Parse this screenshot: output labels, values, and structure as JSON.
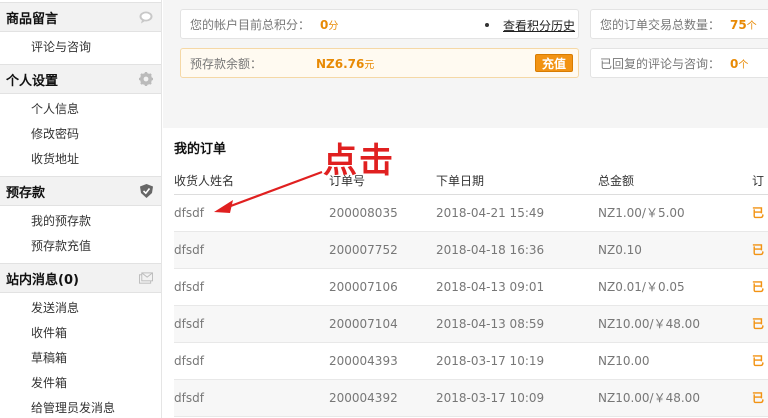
{
  "sidebar": {
    "sections": [
      {
        "title": "商品留言",
        "icon": "chat-bubble-icon",
        "items": [
          "评论与咨询"
        ]
      },
      {
        "title": "个人设置",
        "icon": "gear-icon",
        "items": [
          "个人信息",
          "修改密码",
          "收货地址"
        ]
      },
      {
        "title": "预存款",
        "icon": "shield-icon",
        "items": [
          "我的预存款",
          "预存款充值"
        ]
      },
      {
        "title": "站内消息(0)",
        "icon": "message-icon",
        "items": [
          "发送消息",
          "收件箱",
          "草稿箱",
          "发件箱",
          "给管理员发消息"
        ]
      }
    ]
  },
  "summary": {
    "points_label": "您的帐户目前总积分：",
    "points_value": "0",
    "points_unit": "分",
    "points_history_link": "查看积分历史",
    "balance_label": "预存款余额：",
    "balance_value": "NZ6.76",
    "balance_unit": "元",
    "recharge_button": "充值",
    "orders_total_label": "您的订单交易总数量：",
    "orders_total_value": "75",
    "orders_total_unit": "个",
    "replied_label": "已回复的评论与咨询：",
    "replied_value": "0",
    "replied_unit": "个"
  },
  "orders": {
    "title": "我的订单",
    "columns": [
      "收货人姓名",
      "订单号",
      "下单日期",
      "总金额",
      "订"
    ],
    "rows": [
      {
        "name": "dfsdf",
        "order_no": "200008035",
        "date": "2018-04-21 15:49",
        "amount": "NZ1.00/￥5.00",
        "status": "已"
      },
      {
        "name": "dfsdf",
        "order_no": "200007752",
        "date": "2018-04-18 16:36",
        "amount": "NZ0.10",
        "status": "已"
      },
      {
        "name": "dfsdf",
        "order_no": "200007106",
        "date": "2018-04-13 09:01",
        "amount": "NZ0.01/￥0.05",
        "status": "已"
      },
      {
        "name": "dfsdf",
        "order_no": "200007104",
        "date": "2018-04-13 08:59",
        "amount": "NZ10.00/￥48.00",
        "status": "已"
      },
      {
        "name": "dfsdf",
        "order_no": "200004393",
        "date": "2018-03-17 10:19",
        "amount": "NZ10.00",
        "status": "已"
      },
      {
        "name": "dfsdf",
        "order_no": "200004392",
        "date": "2018-03-17 10:09",
        "amount": "NZ10.00/￥48.00",
        "status": "已"
      }
    ]
  },
  "annotation": {
    "text": "点击",
    "color": "#e02020"
  },
  "colors": {
    "accent": "#f29313",
    "annotation": "#e02020"
  }
}
